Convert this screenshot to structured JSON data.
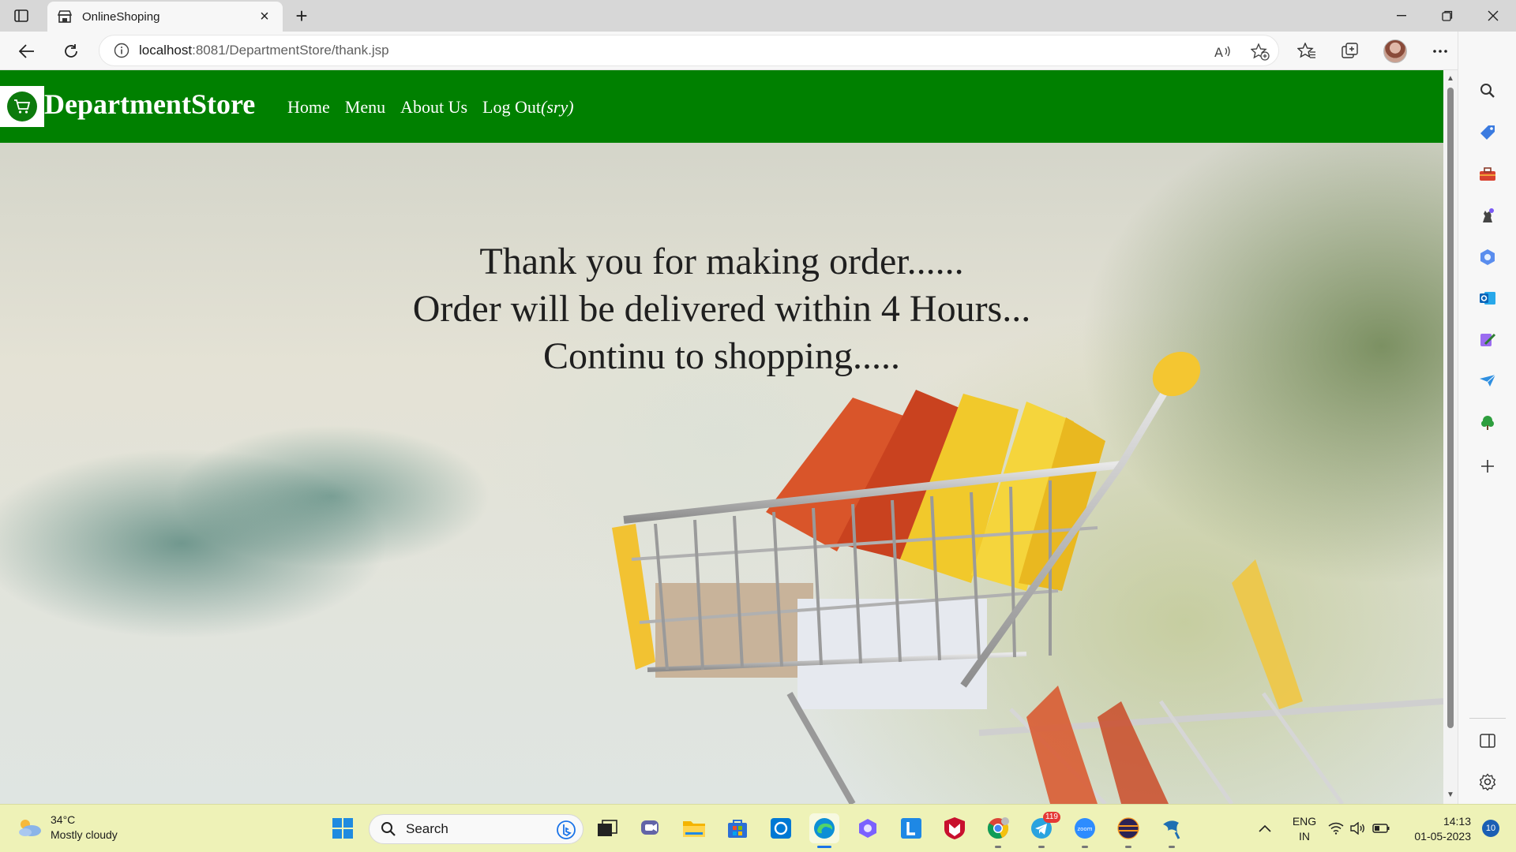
{
  "browser": {
    "tab_title": "OnlineShoping",
    "url_host": "localhost",
    "url_path": ":8081/DepartmentStore/thank.jsp"
  },
  "site": {
    "brand": "DepartmentStore",
    "nav": {
      "home": "Home",
      "menu": "Menu",
      "about": "About Us",
      "logout": "Log Out",
      "logout_user": "(sry)"
    },
    "header_color": "#008000"
  },
  "message": {
    "line1": "Thank you for making order......",
    "line2": "Order will be delivered within 4 Hours...",
    "line3": "Continu to shopping....."
  },
  "taskbar": {
    "weather_temp": "34°C",
    "weather_desc": "Mostly cloudy",
    "search_label": "Search",
    "telegram_badge": "119",
    "lang_top": "ENG",
    "lang_bottom": "IN",
    "time": "14:13",
    "date": "01-05-2023",
    "notifications": "10"
  },
  "icons": {
    "sidebar": [
      "search-icon",
      "tag-icon",
      "toolbox-icon",
      "chess-icon",
      "copilot-icon",
      "outlook-icon",
      "designer-icon",
      "send-icon",
      "tree-icon",
      "add-icon",
      "split-screen-icon",
      "settings-icon"
    ]
  }
}
